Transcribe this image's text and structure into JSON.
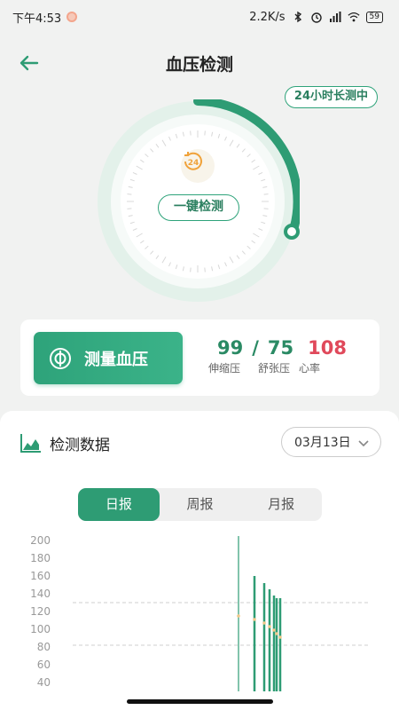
{
  "status_bar": {
    "time": "下午4:53",
    "speed": "2.2K/s",
    "battery": "59"
  },
  "header": {
    "title": "血压检测"
  },
  "mode_pill": "24小时长测中",
  "dial": {
    "button": "一键检测",
    "icon_text": "24"
  },
  "measure": {
    "button_label": "测量血压",
    "systolic": "99",
    "separator": "/",
    "diastolic": "75",
    "heart_rate": "108",
    "systolic_label": "伸缩压",
    "diastolic_label": "舒张压",
    "heart_rate_label": "心率"
  },
  "panel": {
    "title": "检测数据",
    "date": "03月13日",
    "tabs": [
      "日报",
      "周报",
      "月报"
    ],
    "active_tab": 0
  },
  "colors": {
    "accent": "#2e9c74",
    "heart_rate": "#e0495b",
    "dial_light": "#dff0e8"
  },
  "chart_data": {
    "type": "bar",
    "yticks": [
      "200",
      "180",
      "160",
      "140",
      "120",
      "100",
      "80",
      "60",
      "40"
    ],
    "ylim": [
      40,
      200
    ],
    "reference_lines": [
      130,
      82
    ],
    "bars": [
      {
        "low": 40,
        "high": 205
      },
      {
        "low": 40,
        "high": 160
      },
      {
        "low": 40,
        "high": 152
      },
      {
        "low": 40,
        "high": 145
      },
      {
        "low": 40,
        "high": 138
      },
      {
        "low": 40,
        "high": 135
      },
      {
        "low": 40,
        "high": 135
      }
    ]
  }
}
